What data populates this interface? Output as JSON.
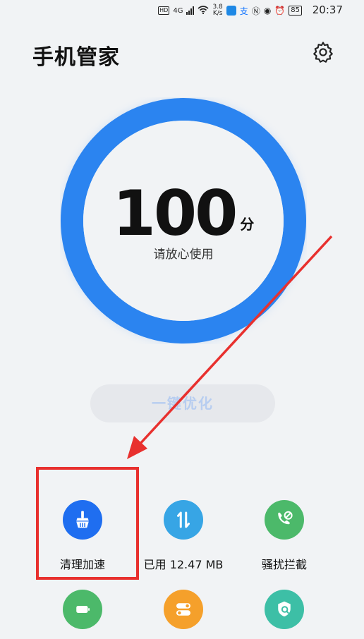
{
  "status_bar": {
    "network": "4G",
    "speed_value": "3.8",
    "speed_unit": "K/s",
    "alipay_glyph": "支",
    "battery": "85",
    "time": "20:37"
  },
  "header": {
    "title": "手机管家"
  },
  "score": {
    "value": "100",
    "unit": "分",
    "status": "请放心使用",
    "ring_fraction": 1.0
  },
  "optimize_button": {
    "label": "一键优化"
  },
  "features": [
    {
      "label": "清理加速",
      "icon": "broom-icon",
      "color": "#1f6ef0"
    },
    {
      "label": "已用 12.47 MB",
      "icon": "data-transfer-icon",
      "color": "#37a5e5"
    },
    {
      "label": "骚扰拦截",
      "icon": "block-call-icon",
      "color": "#4cb96a"
    },
    {
      "label": "",
      "icon": "battery-icon",
      "color": "#4cb96a"
    },
    {
      "label": "",
      "icon": "toggle-icon",
      "color": "#f5a02b"
    },
    {
      "label": "",
      "icon": "shield-scan-icon",
      "color": "#3dbfa6"
    }
  ],
  "colors": {
    "accent": "#2b84f0",
    "annotation": "#e8302e"
  }
}
